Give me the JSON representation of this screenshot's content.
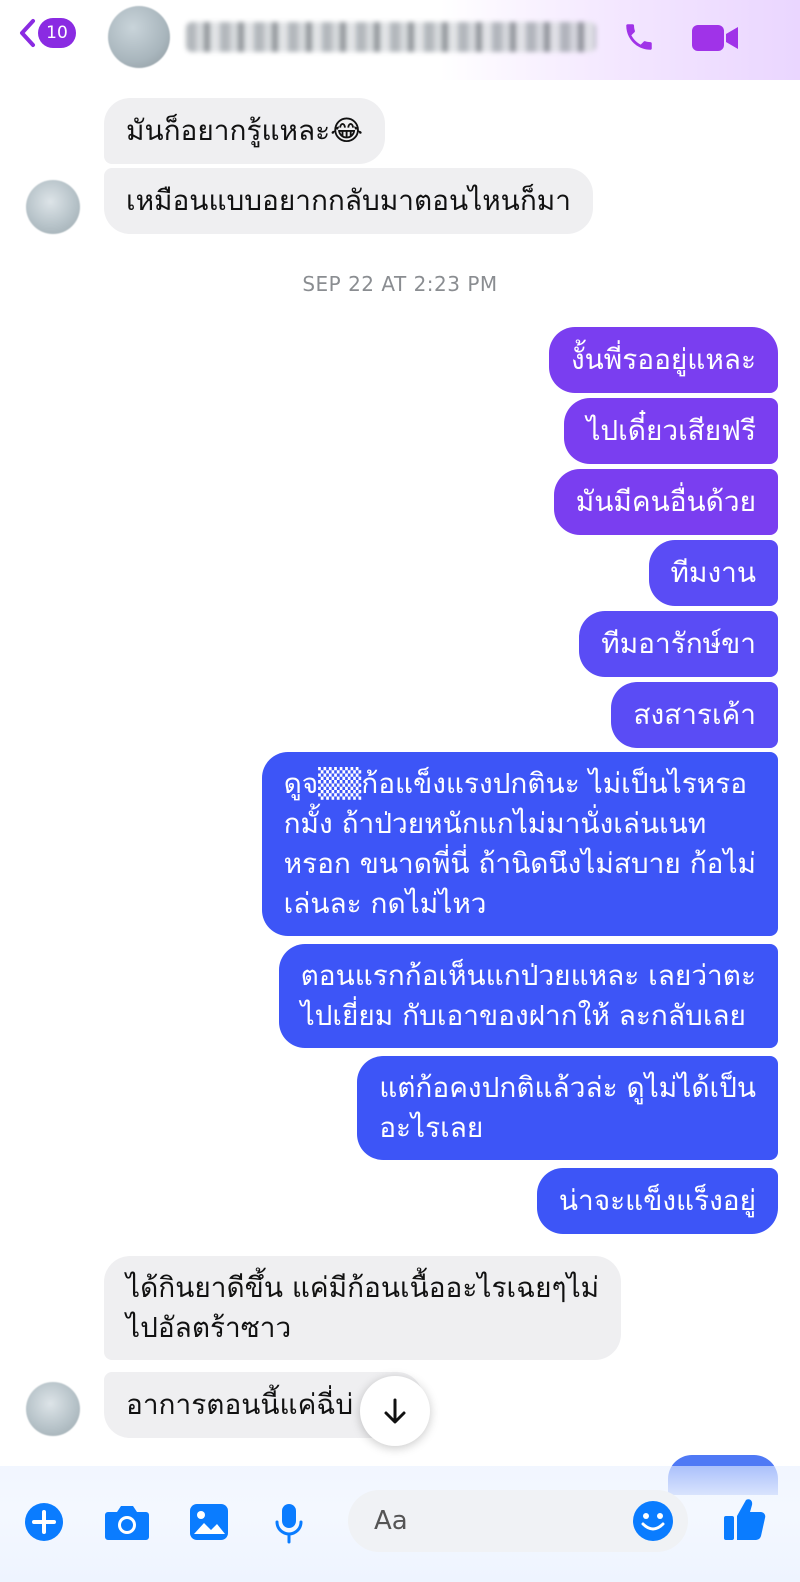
{
  "header": {
    "back_count": "10",
    "contact_name": "",
    "accent": "#8a2be2"
  },
  "messages": [
    {
      "side": "in",
      "text": "มันก็อยากรู้แหละ😂"
    },
    {
      "side": "in",
      "text": "เหมือนแบบอยากกลับมาตอนไหนก็มา"
    },
    {
      "side": "out",
      "text": "งั้นพี่รออยู่แหละ"
    },
    {
      "side": "out",
      "text": "ไปเดี๋ยวเสียฟรี"
    },
    {
      "side": "out",
      "text": "มันมีคนอื่นด้วย"
    },
    {
      "side": "out",
      "text": "ทีมงาน"
    },
    {
      "side": "out",
      "text": "ทีมอารักษ์ขา"
    },
    {
      "side": "out",
      "text": "สงสารเค้า"
    },
    {
      "side": "out",
      "lines": [
        "ดูจ▒▒ก้อแข็งแรงปกตินะ ไม่เป็นไรหรอ",
        "กมั้ง ถ้าป่วยหนักแกไม่มานั่งเล่นเนท",
        "หรอก ขนาดพี่นี่ ถ้านิดนึงไม่สบาย ก้อไม่",
        "เล่นละ กดไม่ไหว"
      ]
    },
    {
      "side": "out",
      "lines": [
        "ตอนแรกก้อเห็นแกป่วยแหละ เลยว่าตะ",
        "ไปเยี่ยม กับเอาของฝากให้ ละกลับเลย"
      ]
    },
    {
      "side": "out",
      "lines": [
        "แต่ก้อคงปกติแล้วล่ะ ดูไม่ได้เป็น",
        "อะไรเลย"
      ]
    },
    {
      "side": "out",
      "text": "น่าจะแข็งแร็งอยู่"
    },
    {
      "side": "in",
      "lines": [
        "ได้กินยาดีขึ้น แค่มีก้อนเนื้ออะไรเฉยๆไม่",
        "ไปอัลตร้าซาว"
      ]
    },
    {
      "side": "in",
      "text": "อาการตอนนี้แค่ฉี่บ่"
    }
  ],
  "timestamp": "SEP 22 AT 2:23 PM",
  "composer": {
    "placeholder": "Aa",
    "icons": [
      "plus-icon",
      "camera-icon",
      "image-icon",
      "microphone-icon",
      "emoji-icon",
      "thumbs-up-icon"
    ]
  },
  "colors": {
    "outgoing_purple": "#7a3ef0",
    "outgoing_violet": "#5a4cf5",
    "outgoing_blue": "#3d55f7",
    "incoming_gray": "#efeff1",
    "messenger_blue": "#0a7cff"
  }
}
